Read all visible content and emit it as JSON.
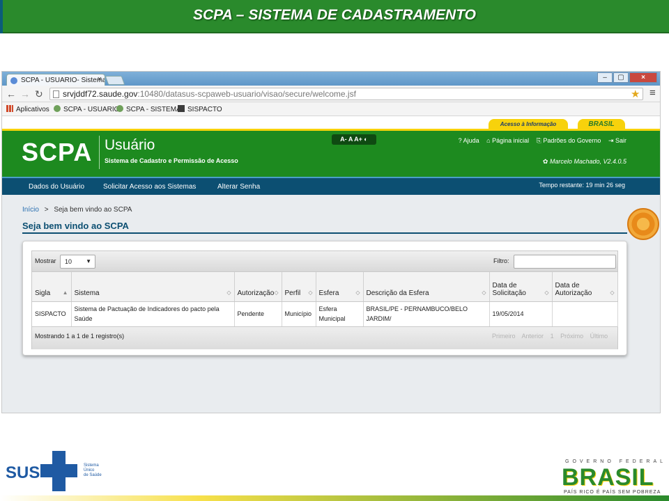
{
  "slide": {
    "title": "SCPA – SISTEMA DE CADASTRAMENTO"
  },
  "browser": {
    "tab_title": "SCPA - USUARIO- Sistema",
    "url_host": "srvjddf72.saude.gov",
    "url_path": ":10480/datasus-scpaweb-usuario/visao/secure/welcome.jsf",
    "bookmarks": [
      "Aplicativos",
      "SCPA - USUARIO",
      "SCPA - SISTEMA",
      "SISPACTO"
    ]
  },
  "govbar": {
    "acesso": "Acesso à Informação",
    "brasil": "BRASIL"
  },
  "site": {
    "logo": "SCPA",
    "app_name": "Usuário",
    "subtitle": "Sistema de Cadastro e Permissão de Acesso",
    "font_controls": "A- A A+ ◐",
    "links": [
      "? Ajuda",
      "⌂ Página inicial",
      "⎘ Padrões do Governo",
      "⇥ Sair"
    ],
    "user_info": "✿ Marcelo Machado, V2.4.0.5"
  },
  "nav": {
    "items": [
      "Dados do Usuário",
      "Solicitar Acesso aos Sistemas",
      "Alterar Senha"
    ],
    "timer": "Tempo restante: 19 min 26 seg"
  },
  "content": {
    "breadcrumb_home": "Início",
    "breadcrumb_sep": ">",
    "breadcrumb_current": "Seja bem vindo ao SCPA",
    "page_title": "Seja bem vindo ao SCPA"
  },
  "table": {
    "mostrar_label": "Mostrar",
    "mostrar_value": "10",
    "filtro_label": "Filtro:",
    "columns": [
      "Sigla",
      "Sistema",
      "Autorização",
      "Perfil",
      "Esfera",
      "Descrição da Esfera",
      "Data de Solicitação",
      "Data de Autorização"
    ],
    "rows": [
      [
        "SISPACTO",
        "Sistema de Pactuação de Indicadores do pacto pela Saúde",
        "Pendente",
        "Município",
        "Esfera Municipal",
        "BRASIL/PE - PERNAMBUCO/BELO JARDIM/",
        "19/05/2014",
        ""
      ]
    ],
    "footer_info": "Mostrando 1 a 1 de 1 registro(s)",
    "pager": [
      "Primeiro",
      "Anterior",
      "1",
      "Próximo",
      "Último"
    ]
  },
  "footer": {
    "sus": "SUS",
    "sus_sub": [
      "Sistema",
      "Único",
      "de Saúde"
    ],
    "gov_top": "GOVERNO FEDERAL",
    "gov_word": "BRASIL",
    "gov_slogan": "PAÍS RICO É PAÍS SEM POBREZA"
  },
  "colors": {
    "slide_green": "#2a8a2c",
    "site_green": "#1d8a1f",
    "nav_blue": "#0c4f72",
    "gov_yellow": "#f7d20c"
  }
}
